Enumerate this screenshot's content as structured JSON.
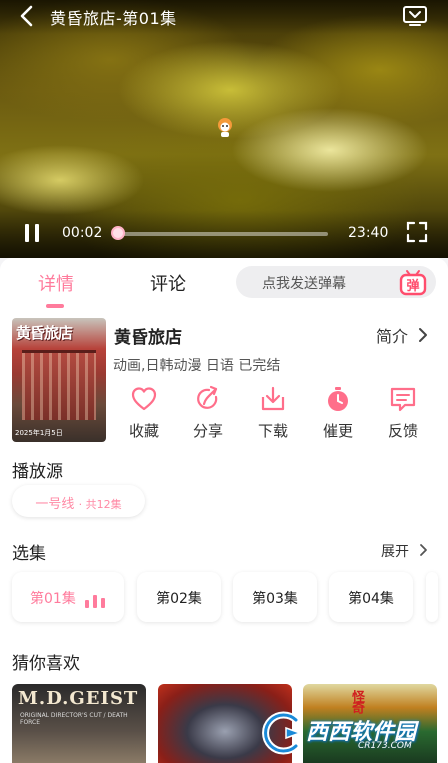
{
  "player": {
    "title": "黄昏旅店-第01集",
    "current_time": "00:02",
    "total_time": "23:40",
    "progress": 0.0014,
    "state": "playing"
  },
  "tabs": [
    {
      "label": "详情",
      "active": true
    },
    {
      "label": "评论",
      "active": false
    }
  ],
  "danmaku": {
    "placeholder": "点我发送弹幕",
    "icon_label": "弹"
  },
  "anime": {
    "title": "黄昏旅店",
    "intro_label": "简介",
    "meta": "动画,日韩动漫 日语 已完结"
  },
  "poster": {
    "logo_text": "黄昏旅店",
    "date_text": "2025年1月5日"
  },
  "actions": [
    {
      "label": "收藏",
      "icon": "heart-icon"
    },
    {
      "label": "分享",
      "icon": "share-icon"
    },
    {
      "label": "下载",
      "icon": "download-icon"
    },
    {
      "label": "催更",
      "icon": "timer-icon"
    },
    {
      "label": "反馈",
      "icon": "feedback-icon"
    }
  ],
  "source": {
    "title": "播放源",
    "selected_name": "一号线",
    "selected_count": "· 共12集"
  },
  "episodes": {
    "title": "选集",
    "expand_label": "展开",
    "items": [
      {
        "label": "第01集",
        "active": true
      },
      {
        "label": "第02集",
        "active": false
      },
      {
        "label": "第03集",
        "active": false
      },
      {
        "label": "第04集",
        "active": false
      }
    ]
  },
  "recommend": {
    "title": "猜你喜欢",
    "items": [
      {
        "cover_text": "M.D.GEIST",
        "cover_sub": "ORIGINAL DIRECTOR'S CUT / DEATH FORCE"
      },
      {
        "cover_text": ""
      },
      {
        "cover_text": "怪奇"
      }
    ]
  },
  "watermark": {
    "brand": "西西软件园",
    "domain": "CR173.COM"
  },
  "colors": {
    "accent": "#ff7b9c",
    "background": "#f4f4f6"
  }
}
